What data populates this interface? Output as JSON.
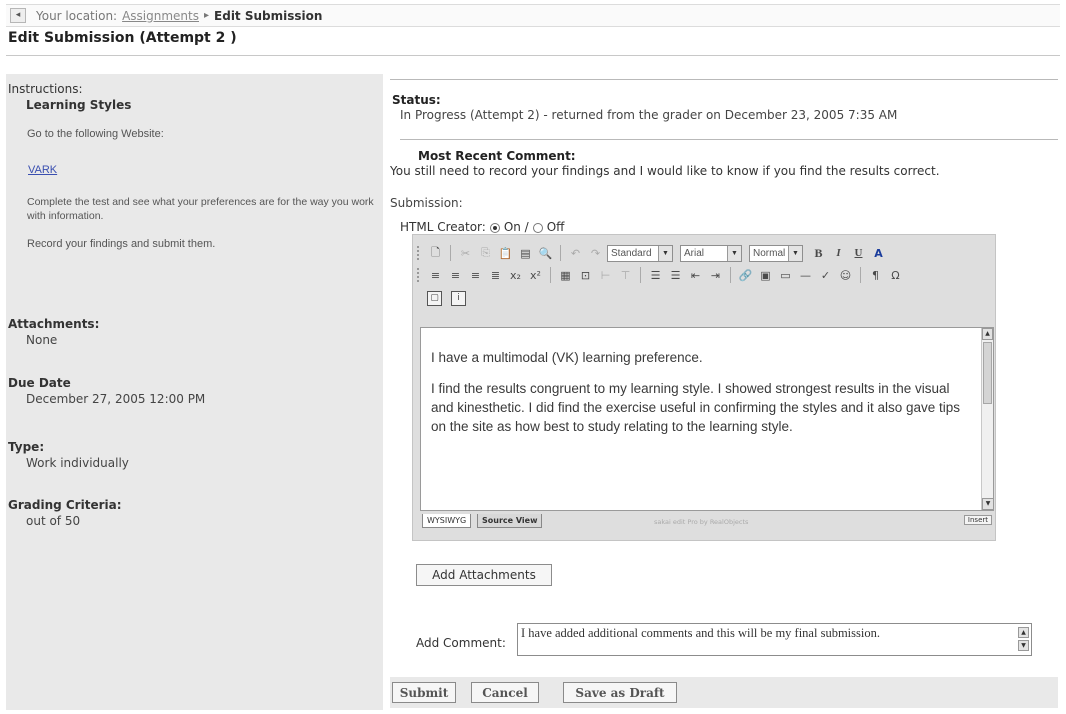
{
  "breadcrumb": {
    "prefix": "Your location:",
    "link": "Assignments",
    "separator": "▸",
    "current": "Edit Submission"
  },
  "page": {
    "title": "Edit Submission (Attempt 2 )"
  },
  "left": {
    "instructions_label": "Instructions:",
    "instructions_title": "Learning Styles",
    "instr_line1": "Go to the following Website:",
    "vark_link": "VARK",
    "instr_line2": "Complete the test and see what your preferences are for the way you work with information.",
    "instr_line3": "Record your findings and submit them.",
    "attachments_label": "Attachments:",
    "attachments_value": "None",
    "due_label": "Due Date",
    "due_value": "December 27, 2005 12:00 PM",
    "type_label": "Type:",
    "type_value": "Work individually",
    "grading_label": "Grading Criteria:",
    "grading_value": "out of 50"
  },
  "status": {
    "label": "Status:",
    "text": "In Progress (Attempt 2) - returned from the grader on December 23, 2005 7:35 AM"
  },
  "comment": {
    "label": "Most Recent Comment:",
    "text": "You still need to record your findings and I would like to know if you find the results correct."
  },
  "submission": {
    "label": "Submission:",
    "html_creator_label": "HTML Creator:",
    "on_label": "On /",
    "off_label": "Off",
    "html_creator_selected": "On"
  },
  "editor": {
    "style_select": "Standard",
    "font_select": "Arial",
    "size_select": "Normal",
    "paragraph1": "I have a multimodal (VK) learning preference.",
    "paragraph2": "I find the results congruent to my learning style. I showed strongest results in the visual and kinesthetic. I did find the exercise useful in confirming the styles and it also gave tips on the site as how best to study relating to the learning style.",
    "tab_wysiwyg": "WYSIWYG",
    "tab_source": "Source View",
    "powered_by": "sakai edit Pro by RealObjects",
    "insert_label": "Insert"
  },
  "attachments_button": "Add Attachments",
  "add_comment": {
    "label": "Add Comment:",
    "value": "I have added additional comments and this will be my final submission."
  },
  "actions": {
    "submit": "Submit",
    "cancel": "Cancel",
    "draft": "Save as Draft"
  }
}
